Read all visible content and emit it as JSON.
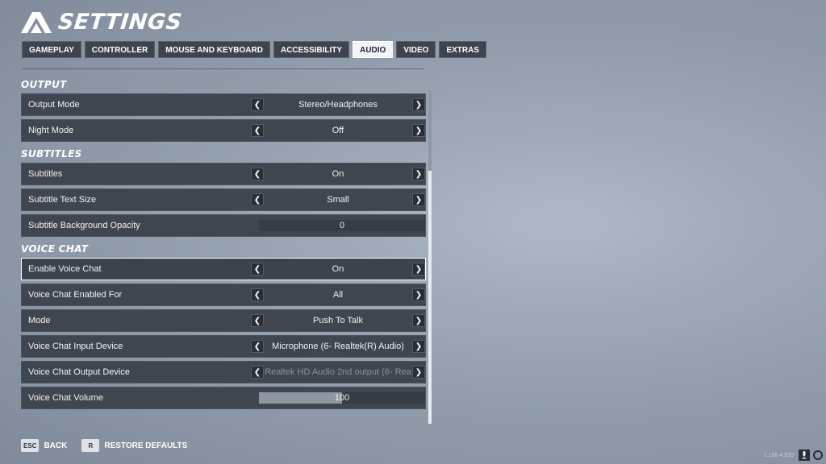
{
  "header": {
    "title": "SETTINGS"
  },
  "tabs": [
    {
      "label": "GAMEPLAY",
      "active": false
    },
    {
      "label": "CONTROLLER",
      "active": false
    },
    {
      "label": "MOUSE AND KEYBOARD",
      "active": false
    },
    {
      "label": "ACCESSIBILITY",
      "active": false
    },
    {
      "label": "AUDIO",
      "active": true
    },
    {
      "label": "VIDEO",
      "active": false
    },
    {
      "label": "EXTRAS",
      "active": false
    }
  ],
  "sections": {
    "output": {
      "title": "OUTPUT",
      "rows": [
        {
          "label": "Output Mode",
          "value": "Stereo/Headphones"
        },
        {
          "label": "Night Mode",
          "value": "Off"
        }
      ]
    },
    "subtitles": {
      "title": "SUBTITLES",
      "rows": [
        {
          "label": "Subtitles",
          "value": "On"
        },
        {
          "label": "Subtitle Text Size",
          "value": "Small"
        },
        {
          "label": "Subtitle Background Opacity",
          "value": "0",
          "slider_level": 0
        }
      ]
    },
    "voice_chat": {
      "title": "VOICE CHAT",
      "rows": [
        {
          "label": "Enable Voice Chat",
          "value": "On"
        },
        {
          "label": "Voice Chat Enabled For",
          "value": "All"
        },
        {
          "label": "Mode",
          "value": "Push To Talk"
        },
        {
          "label": "Voice Chat Input Device",
          "value": "Microphone (6- Realtek(R) Audio)"
        },
        {
          "label": "Voice Chat Output Device",
          "value": "Realtek HD Audio 2nd output (6- Rea"
        },
        {
          "label": "Voice Chat Volume",
          "value": "100",
          "slider_level": 0.5
        }
      ]
    }
  },
  "footer": {
    "back_key": "ESC",
    "back_label": "BACK",
    "restore_key": "R",
    "restore_label": "RESTORE DEFAULTS"
  },
  "corner": {
    "version": "1.105.4.835"
  },
  "colors": {
    "accent": "#ffffff",
    "row_bg": "#3f4650",
    "tab_active": "#f2f4f7"
  }
}
